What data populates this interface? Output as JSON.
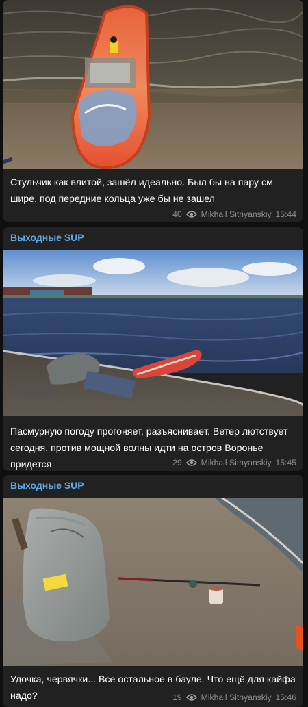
{
  "posts": [
    {
      "caption": "Стульчик как влитой, зашёл идеально. Был бы на пару см шире, под передние кольца уже бы не зашел",
      "views": "40",
      "meta": "Mikhail Sitnyanskiy, 15:44"
    },
    {
      "channel": "Выходные SUP",
      "caption": "Пасмурную погоду прогоняет, разъясниваeт. Ветер лютствует сегодня, против мощной волны идти на остров Воронье придется",
      "views": "29",
      "meta": "Mikhail Sitnyanskiy, 15:45"
    },
    {
      "channel": "Выходные SUP",
      "caption": "Удочка, червячки... Все остальное в бауле. Что ещё для кайфа надо?",
      "views": "19",
      "meta": "Mikhail Sitnyanskiy, 15:46"
    }
  ],
  "icons": {
    "views": "eye-icon"
  },
  "colors": {
    "bubble": "#212121",
    "channel_name": "#60a9e6",
    "meta": "#8f8f8f"
  }
}
